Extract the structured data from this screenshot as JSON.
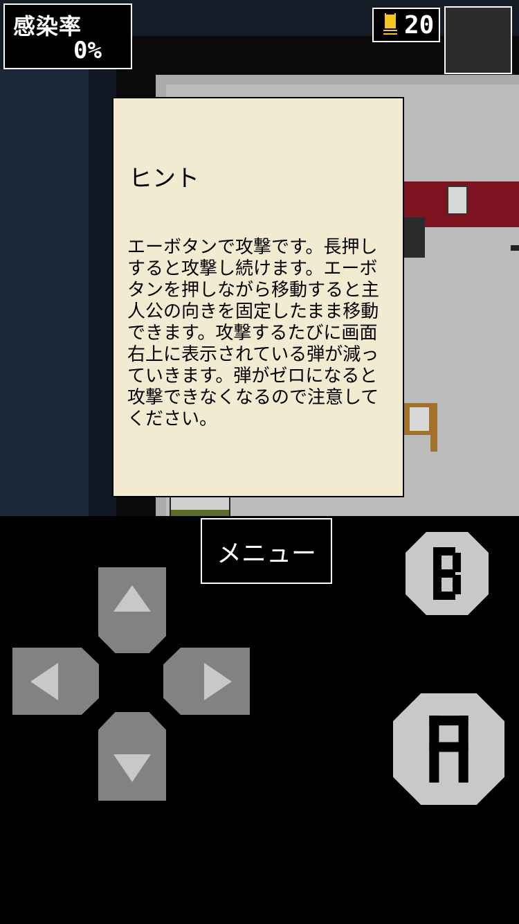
{
  "hud": {
    "infection_label": "感染率",
    "infection_value": "0%",
    "ammo_count": "20",
    "ammo_icon": "bullet-icon",
    "item_slot": "empty-item-slot"
  },
  "dialog": {
    "title": "ヒント",
    "body": "エーボタンで攻撃です。長押しすると攻撃し続けます。エーボタンを押しながら移動すると主人公の向きを固定したまま移動できます。攻撃するたびに画面右上に表示されている弾が減っていきます。弾がゼロになると攻撃できなくなるので注意してください。"
  },
  "controls": {
    "menu_label": "メニュー",
    "dpad_icons": [
      "up-arrow-icon",
      "left-arrow-icon",
      "right-arrow-icon",
      "down-arrow-icon"
    ],
    "b_button_label": "B",
    "a_button_label": "A"
  },
  "colors": {
    "dialog_bg": "#f3ead2",
    "control_gray": "#828282",
    "button_light": "#c8c8c8",
    "bullet_yellow": "#f3c623"
  }
}
